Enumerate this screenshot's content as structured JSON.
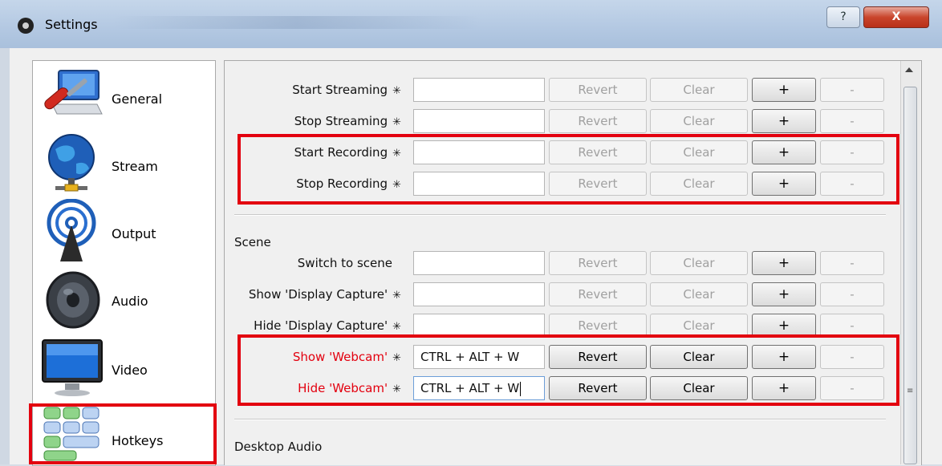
{
  "window": {
    "title": "Settings",
    "help_label": "?",
    "close_label": "X"
  },
  "sidebar": {
    "items": [
      {
        "label": "General",
        "icon": "general-icon"
      },
      {
        "label": "Stream",
        "icon": "globe-icon"
      },
      {
        "label": "Output",
        "icon": "broadcast-icon"
      },
      {
        "label": "Audio",
        "icon": "speaker-icon"
      },
      {
        "label": "Video",
        "icon": "monitor-icon"
      },
      {
        "label": "Hotkeys",
        "icon": "keyboard-icon",
        "selected": true
      }
    ]
  },
  "hotkeys": {
    "button_labels": {
      "revert": "Revert",
      "clear": "Clear",
      "add": "+",
      "remove": "-"
    },
    "star": "✳",
    "rows": [
      {
        "label": "Start Streaming",
        "value": ""
      },
      {
        "label": "Stop Streaming",
        "value": ""
      },
      {
        "label": "Start Recording",
        "value": ""
      },
      {
        "label": "Stop Recording",
        "value": ""
      },
      {
        "label": "Switch to scene",
        "value": ""
      },
      {
        "label": "Show 'Display Capture'",
        "value": ""
      },
      {
        "label": "Hide 'Display Capture'",
        "value": ""
      },
      {
        "label": "Show 'Webcam'",
        "value": "CTRL + ALT + W"
      },
      {
        "label": "Hide 'Webcam'",
        "value": "CTRL + ALT + W"
      }
    ],
    "sections": {
      "scene": "Scene",
      "desktop_audio": "Desktop Audio"
    }
  },
  "colors": {
    "highlight_box": "#e3000f",
    "changed_label": "#e3000f"
  }
}
